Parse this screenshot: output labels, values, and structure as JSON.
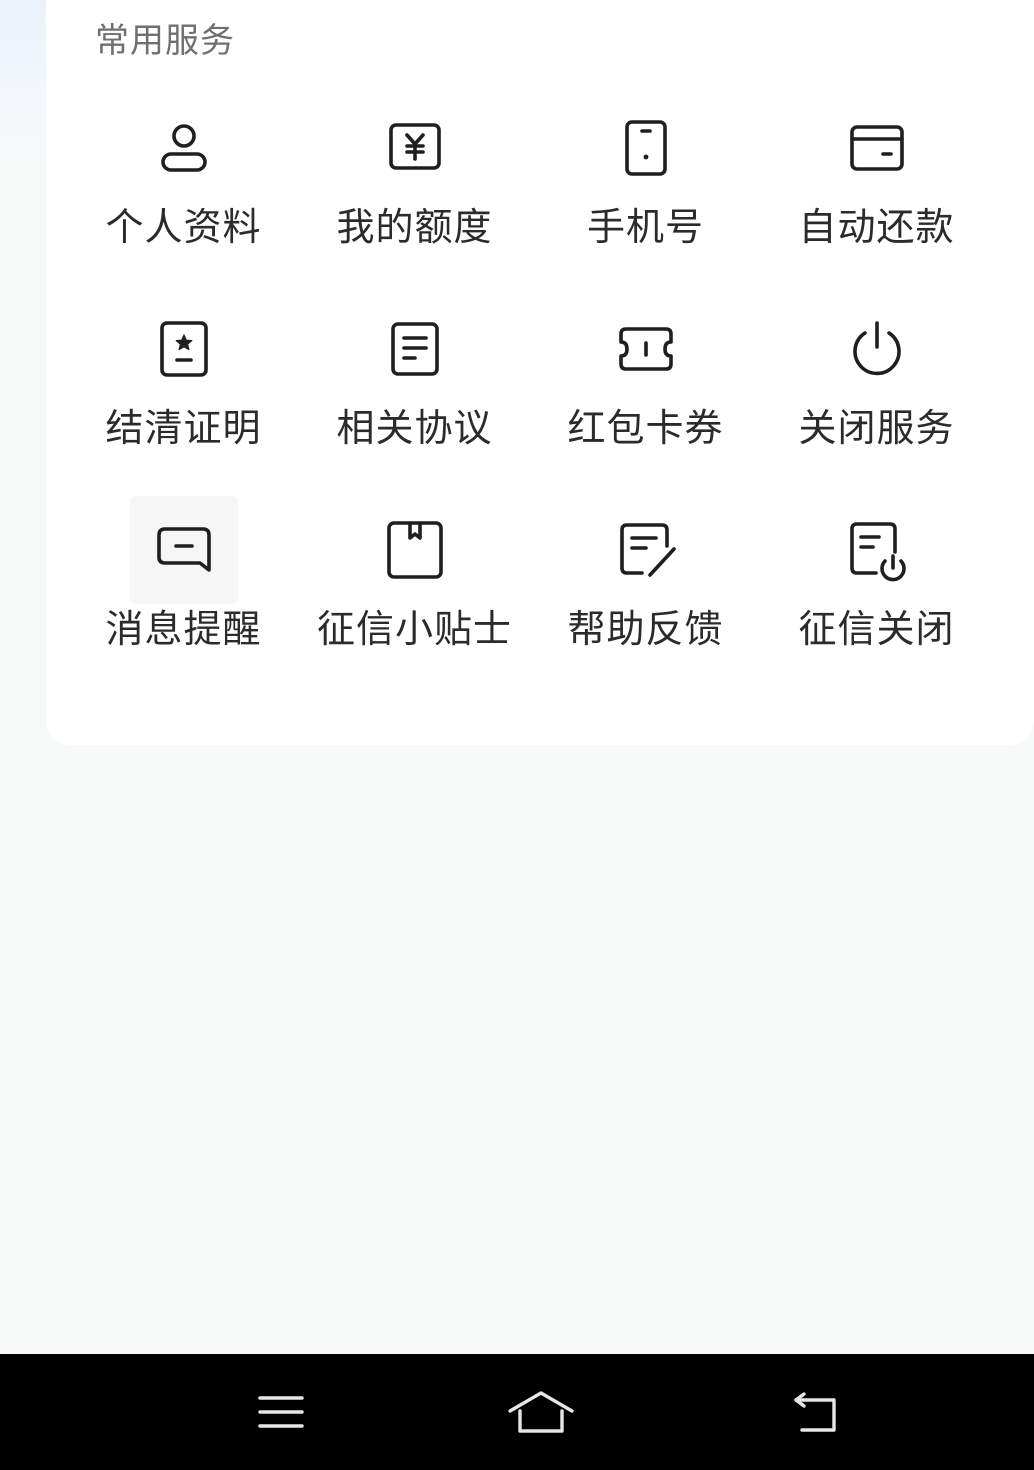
{
  "section": {
    "title": "常用服务"
  },
  "services": [
    {
      "label": "个人资料",
      "icon": "user-icon"
    },
    {
      "label": "我的额度",
      "icon": "yuan-card-icon"
    },
    {
      "label": "手机号",
      "icon": "phone-icon"
    },
    {
      "label": "自动还款",
      "icon": "card-icon"
    },
    {
      "label": "结清证明",
      "icon": "certificate-star-icon"
    },
    {
      "label": "相关协议",
      "icon": "document-icon"
    },
    {
      "label": "红包卡券",
      "icon": "ticket-icon"
    },
    {
      "label": "关闭服务",
      "icon": "power-icon"
    },
    {
      "label": "消息提醒",
      "icon": "message-icon"
    },
    {
      "label": "征信小贴士",
      "icon": "bookmark-book-icon"
    },
    {
      "label": "帮助反馈",
      "icon": "edit-document-icon"
    },
    {
      "label": "征信关闭",
      "icon": "document-power-icon"
    }
  ],
  "navigation": {
    "menu_icon": "menu-icon",
    "home_icon": "home-icon",
    "back_icon": "back-icon"
  },
  "colors": {
    "icon_stroke": "#1f1f1f",
    "label_text": "#2b2b2b",
    "section_title": "#6f6f6f",
    "card_background": "#ffffff",
    "page_background": "#f7f9f9",
    "nav_background": "#000000",
    "nav_icon": "#e6e6e6"
  }
}
